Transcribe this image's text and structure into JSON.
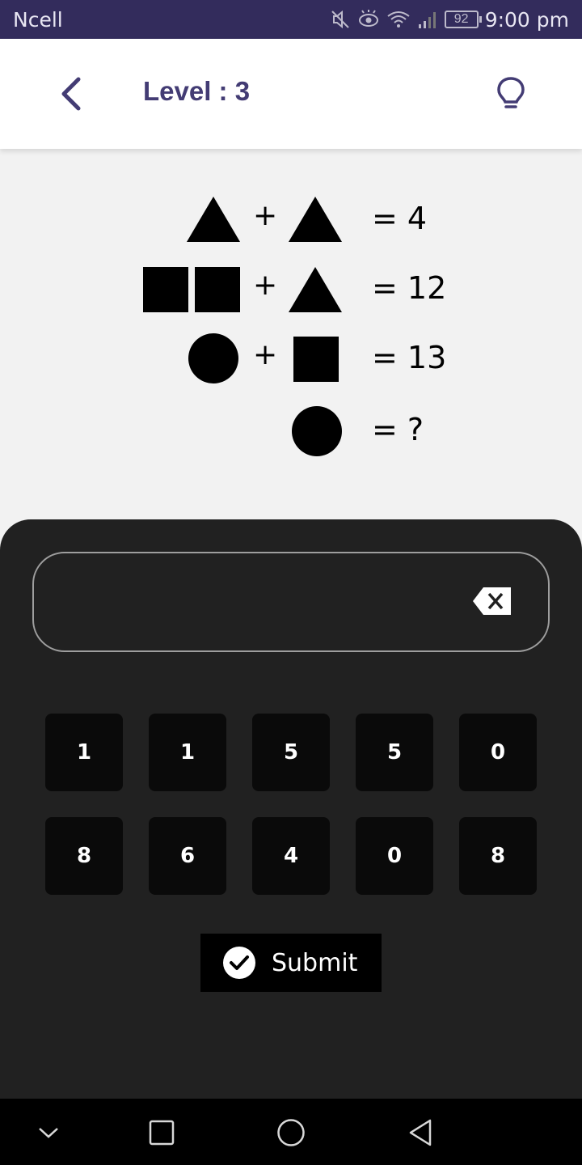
{
  "status_bar": {
    "carrier": "Ncell",
    "battery": "92",
    "time": "9:00 pm",
    "icons": [
      "mute-icon",
      "eye-icon",
      "wifi-icon",
      "signal-icon",
      "battery-icon"
    ]
  },
  "header": {
    "title": "Level : 3",
    "back_icon": "chevron-left-icon",
    "hint_icon": "lightbulb-icon",
    "accent_color": "#433c74",
    "status_color": "#332c5c"
  },
  "puzzle": {
    "equations": [
      {
        "shapes": [
          "triangle",
          "+",
          "triangle"
        ],
        "result": "= 4"
      },
      {
        "shapes": [
          "square",
          "square",
          "+",
          "triangle"
        ],
        "result": "= 12"
      },
      {
        "shapes": [
          "circle",
          "+",
          "square"
        ],
        "result": "= 13"
      },
      {
        "shapes": [
          "circle"
        ],
        "result": "= ?"
      }
    ],
    "plus": "+"
  },
  "answer": {
    "value": "",
    "backspace_icon": "backspace-icon"
  },
  "keypad": {
    "row1": [
      "1",
      "1",
      "5",
      "5",
      "0"
    ],
    "row2": [
      "8",
      "6",
      "4",
      "0",
      "8"
    ]
  },
  "submit": {
    "label": "Submit",
    "icon": "check-circle-icon"
  },
  "nav_bar": {
    "icons": [
      "chevron-down-icon",
      "recents-icon",
      "home-icon",
      "back-icon"
    ]
  }
}
